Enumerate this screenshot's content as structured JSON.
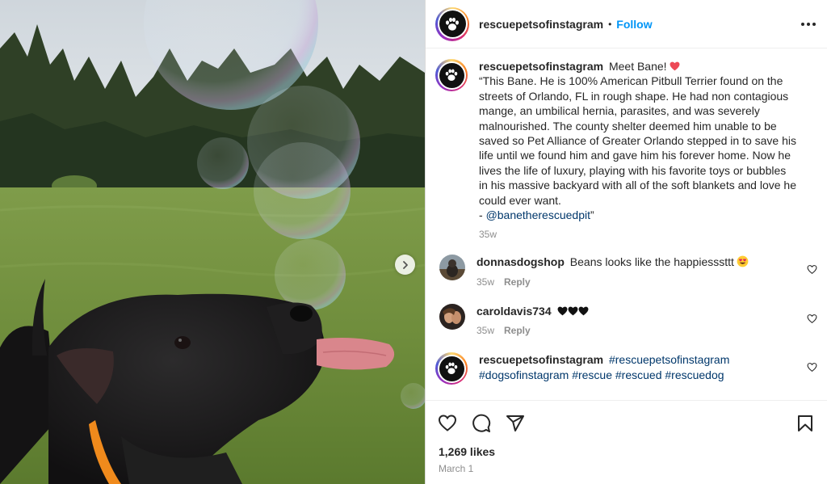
{
  "post": {
    "username": "rescuepetsofinstagram",
    "follow_label": "Follow",
    "separator": "•"
  },
  "caption": {
    "username": "rescuepetsofinstagram",
    "lead": "Meet Bane!",
    "text": "“This Bane. He is 100% American Pitbull Terrier found on the streets of Orlando, FL in rough shape. He had non contagious mange, an umbilical hernia, parasites, and was severely malnourished. The county shelter deemed him unable to be saved so Pet Alliance of Greater Orlando stepped in to save his life until we found him and gave him his forever home. Now he lives the life of luxury, playing with his favorite toys or bubbles in his massive backyard with all of the soft blankets and love he could ever want.",
    "credit_prefix": "- ",
    "credit_handle": "@banetherescuedpit",
    "credit_suffix": "”",
    "time": "35w"
  },
  "comments": [
    {
      "username": "donnasdogshop",
      "text": "Beans looks like the happiesssttt",
      "time": "35w",
      "reply": "Reply"
    },
    {
      "username": "caroldavis734",
      "text": "",
      "time": "35w",
      "reply": "Reply"
    },
    {
      "username": "rescuepetsofinstagram",
      "tags": [
        "#rescuepetsofinstagram",
        "#dogsofinstagram",
        "#rescue",
        "#rescued",
        "#rescuedog"
      ]
    }
  ],
  "footer": {
    "likes": "1,269 likes",
    "date": "March 1"
  },
  "icons": {
    "like": "heart-icon",
    "comment": "comment-icon",
    "share": "share-icon",
    "save": "bookmark-icon",
    "more": "more-icon",
    "carousel_next": "chevron-right-icon",
    "avatar": "paw-icon"
  },
  "colors": {
    "accent": "#0095f6",
    "link": "#00376b",
    "muted": "#8e8e8e",
    "heart": "#ed4956"
  }
}
